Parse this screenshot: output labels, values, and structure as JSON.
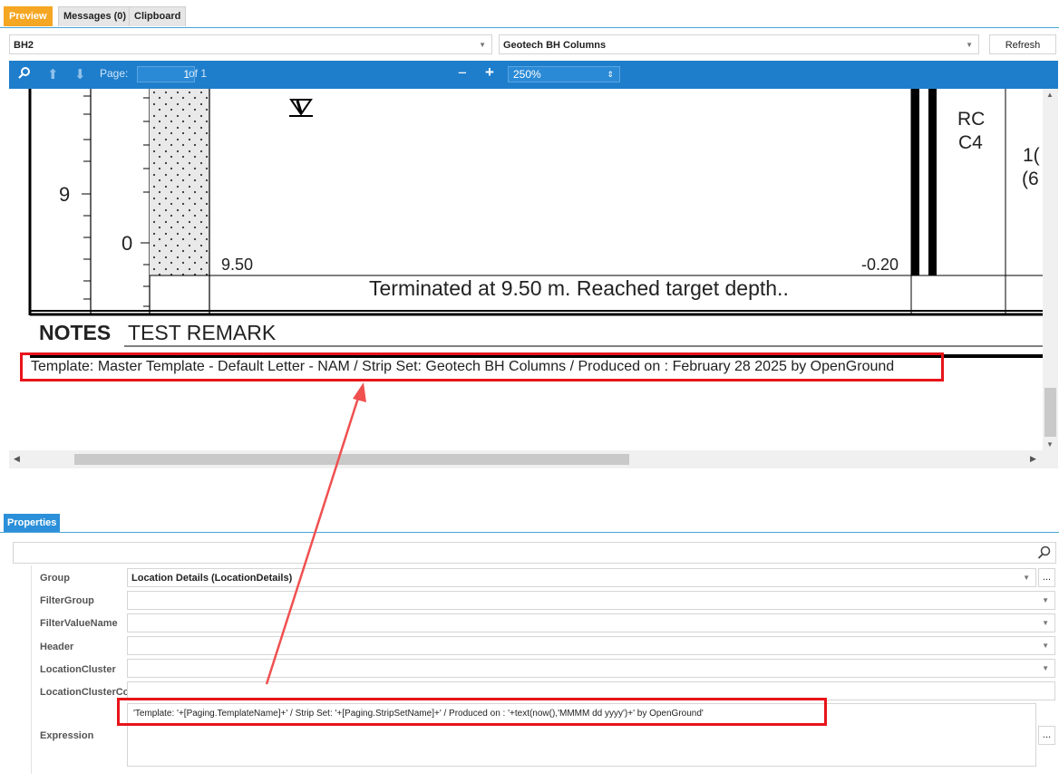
{
  "tabs": [
    "Preview",
    "Messages (0)",
    "Clipboard"
  ],
  "location_select": "BH2",
  "strip_select": "Geotech BH Columns",
  "refresh_label": "Refresh",
  "viewer": {
    "page_label": "Page:",
    "page_value": "1",
    "page_of": "of 1",
    "zoom": "250%"
  },
  "document": {
    "depth_labels": [
      "9",
      "0"
    ],
    "depth_value": "9.50",
    "level_value": "-0.20",
    "core_label_1": "RC",
    "core_label_2": "C4",
    "partial_1": "1(",
    "partial_2": "(6",
    "terminated": "Terminated at 9.50 m. Reached target depth..",
    "notes_heading": "NOTES",
    "notes_text": "TEST REMARK",
    "footer": "Template: Master Template - Default Letter - NAM / Strip Set: Geotech BH Columns / Produced on : February 28 2025 by OpenGround"
  },
  "properties": {
    "tab": "Properties",
    "rows": [
      {
        "label": "Group",
        "value": "Location Details (LocationDetails)"
      },
      {
        "label": "FilterGroup",
        "value": ""
      },
      {
        "label": "FilterValueName",
        "value": ""
      },
      {
        "label": "Header",
        "value": ""
      },
      {
        "label": "LocationCluster",
        "value": ""
      },
      {
        "label": "LocationClusterCo",
        "value": ""
      }
    ],
    "expression_label": "Expression",
    "expression_value": "'Template: '+[Paging.TemplateName]+' / Strip Set: '+[Paging.StripSetName]+' / Produced on : '+text(now(),'MMMM dd yyyy')+' by OpenGround'"
  },
  "colors": {
    "accent": "#f5a623",
    "toolbar": "#1f7ecb",
    "highlight": "#e8141a",
    "arrow": "#f05050"
  }
}
